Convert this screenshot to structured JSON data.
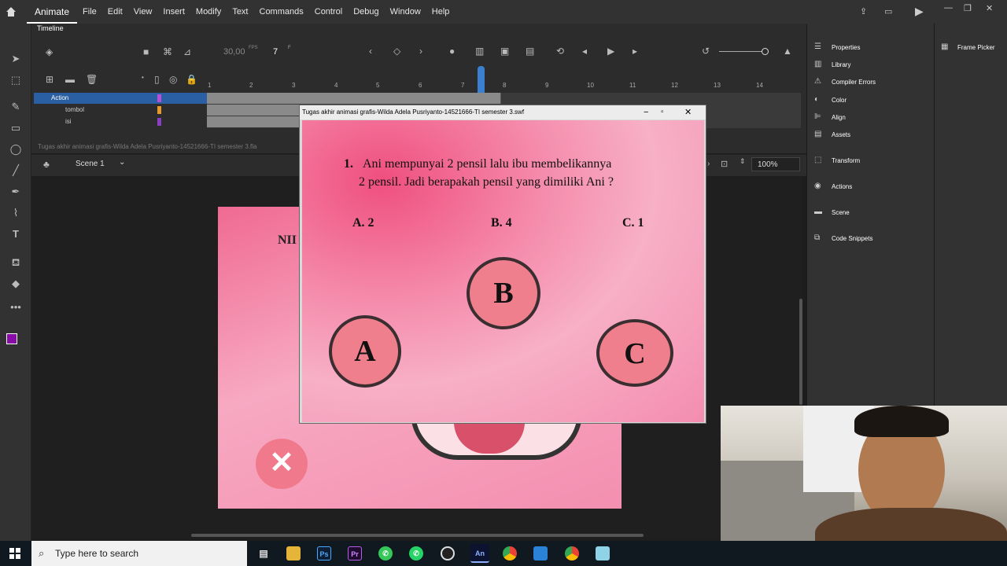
{
  "menubar": {
    "app": "Animate",
    "items": [
      "File",
      "Edit",
      "View",
      "Insert",
      "Modify",
      "Text",
      "Commands",
      "Control",
      "Debug",
      "Window",
      "Help"
    ]
  },
  "timeline": {
    "tab": "Timeline",
    "fps": "30,00",
    "fps_unit": "FPS",
    "frame": "7",
    "frame_unit": "F",
    "ruler": [
      "1",
      "2",
      "3",
      "4",
      "5",
      "6",
      "7",
      "8",
      "9",
      "10",
      "11",
      "12",
      "13",
      "14"
    ],
    "layers": [
      {
        "name": "Action",
        "color": "#b84fd6"
      },
      {
        "name": "tombol",
        "color": "#e69a2e"
      },
      {
        "name": "isi",
        "color": "#8a3fc0"
      }
    ]
  },
  "stage": {
    "filename": "Tugas akhir animasi grafis-Wilda Adela Pusriyanto-14521666-TI semester 3.fla",
    "scene": "Scene 1",
    "zoom": "100%",
    "artboard_partial_text": "NII"
  },
  "swf": {
    "title": "Tugas akhir animasi grafis-Wilda Adela Pusriyanto-14521666-TI semester 3.swf",
    "question_number": "1.",
    "question_line1": "Ani mempunyai 2 pensil lalu ibu membelikannya",
    "question_line2": "2 pensil. Jadi berapakah pensil yang dimiliki Ani ?",
    "options": [
      "A. 2",
      "B. 4",
      "C. 1"
    ],
    "buttons": [
      "A",
      "B",
      "C"
    ]
  },
  "panels": {
    "items": [
      "Properties",
      "Library",
      "Compiler Errors",
      "Color",
      "Align",
      "Assets",
      "Transform",
      "Actions",
      "Scene",
      "Code Snippets"
    ],
    "frame_picker": "Frame Picker"
  },
  "taskbar": {
    "search_placeholder": "Type here to search",
    "apps": [
      "Ps",
      "Pr",
      "An"
    ]
  },
  "colors": {
    "accent_playhead": "#3b7fd0",
    "selected_layer": "#2b5fa3",
    "stage_pink": "#f48fb0",
    "button_pink": "#f07f8d"
  }
}
